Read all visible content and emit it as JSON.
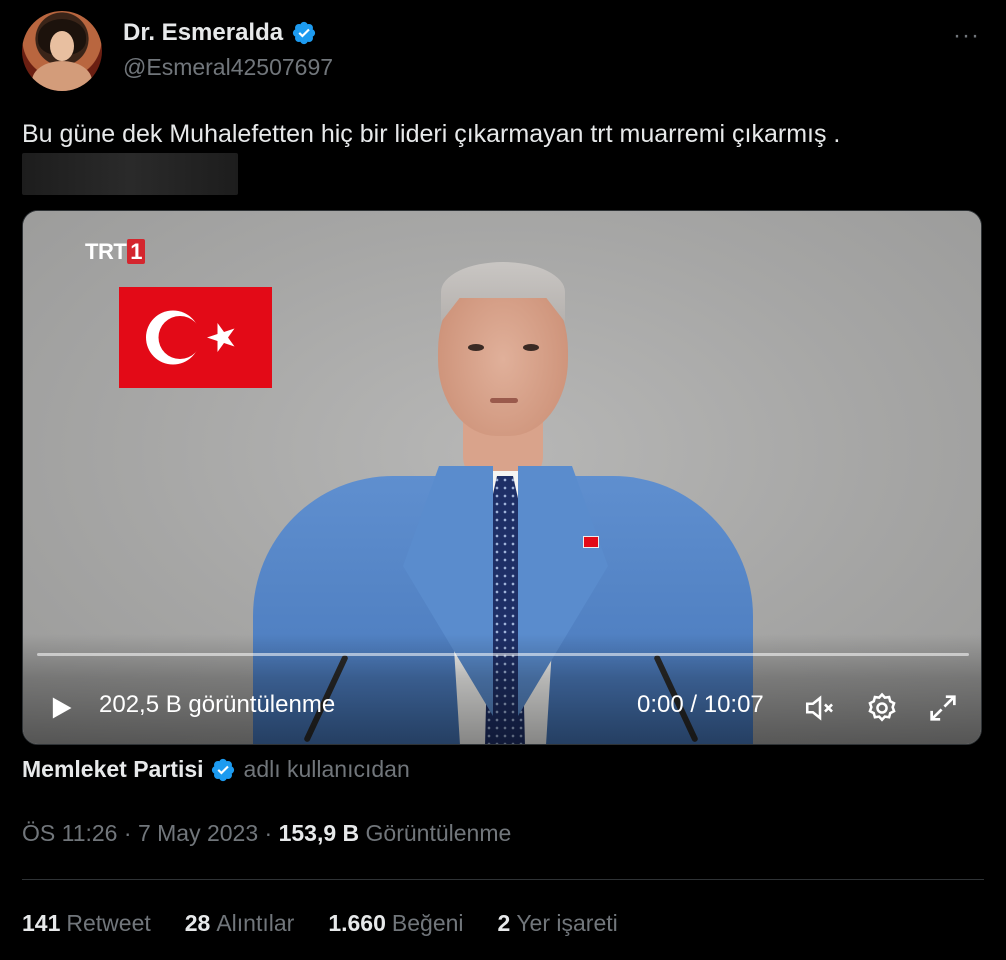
{
  "author": {
    "display_name": "Dr. Esmeralda",
    "handle": "@Esmeral42507697",
    "verified": true
  },
  "more_icon": "more-horizontal-icon",
  "tweet": {
    "text": "Bu güne dek Muhalefetten hiç bir lideri çıkarmayan trt muarremi çıkarmış ."
  },
  "video": {
    "channel_logo": "TRT",
    "channel_logo_number": "1",
    "views": "202,5 B görüntülenme",
    "time": "0:00 / 10:07",
    "progress": 0,
    "icons": [
      "play-icon",
      "mute-icon",
      "settings-icon",
      "fullscreen-icon"
    ]
  },
  "source": {
    "name": "Memleket Partisi",
    "suffix": "adlı kullanıcıdan",
    "verified": true
  },
  "meta": {
    "time": "ÖS 11:26",
    "separator1": " · ",
    "date": "7 May 2023",
    "separator2": " · ",
    "views_count": "153,9 B",
    "views_label": " Görüntülenme"
  },
  "stats": [
    {
      "num": "141",
      "label": "Retweet"
    },
    {
      "num": "28",
      "label": "Alıntılar"
    },
    {
      "num": "1.660",
      "label": "Beğeni"
    },
    {
      "num": "2",
      "label": "Yer işareti"
    }
  ],
  "colors": {
    "background": "#000000",
    "text": "#e7e9ea",
    "muted": "#71767b",
    "verified": "#1d9bf0",
    "flag_red": "#e30a17"
  }
}
